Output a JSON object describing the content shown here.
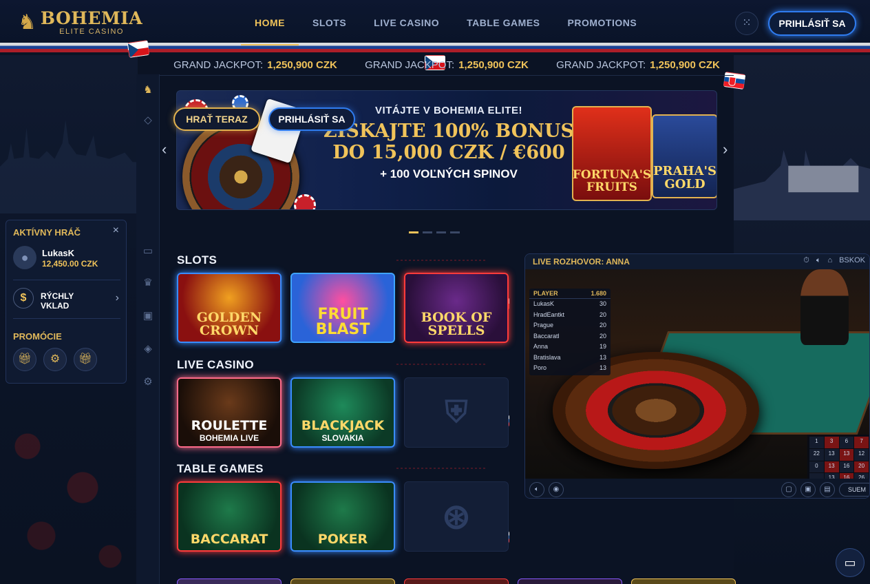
{
  "brand": {
    "name": "BOHEMIA",
    "subtitle": "ELITE CASINO"
  },
  "nav": {
    "items": [
      "HOME",
      "SLOTS",
      "LIVE CASINO",
      "TABLE GAMES",
      "PROMOTIONS"
    ],
    "active": "HOME"
  },
  "header": {
    "login_label": "PRIHLÁSIŤ SA",
    "grid_icon": "grid-icon"
  },
  "jackpots": [
    {
      "label": "GRAND JACKPOT:",
      "value": "1,250,900 CZK"
    },
    {
      "label": "GRAND JACKPOT:",
      "value": "1,250,900 CZK"
    },
    {
      "label": "GRAND JACKPOT:",
      "value": "1,250,900 CZK"
    }
  ],
  "hero": {
    "welcome": "VITÁJTE V BOHEMIA ELITE!",
    "bonus_line1": "ZÍSKAJTE 100% BONUS",
    "bonus_line2": "DO 15,000 CZK / €600",
    "spins": "+ 100 VOĽNÝCH SPINOV",
    "play_label": "HRAŤ TERAZ",
    "login_label": "PRIHLÁSIŤ SA",
    "tile1": "FORTUNA'S FRUITS",
    "tile2": "PRAHA'S GOLD",
    "slide_count": 4,
    "active_slide": 1
  },
  "player": {
    "header": "AKTÍVNY HRÁČ",
    "name": "LukasK",
    "balance": "12,450.00 CZK",
    "deposit_line1": "RÝCHLY",
    "deposit_line2": "VKLAD",
    "promo_header": "PROMÓCIE"
  },
  "sections": {
    "slots": {
      "title": "SLOTS",
      "flag": "cz"
    },
    "live": {
      "title": "LIVE CASINO",
      "flag": "sk"
    },
    "table": {
      "title": "TABLE GAMES",
      "flag": "sk"
    }
  },
  "games": {
    "slots": [
      {
        "title": "GOLDEN CROWN",
        "sub": ""
      },
      {
        "title": "FRUIT BLAST",
        "sub": ""
      },
      {
        "title": "BOOK OF SPELLS",
        "sub": ""
      }
    ],
    "live": [
      {
        "title": "ROULETTE",
        "sub": "BOHEMIA LIVE"
      },
      {
        "title": "BLACKJACK",
        "sub": "SLOVAKIA"
      }
    ],
    "table": [
      {
        "title": "BACCARAT",
        "sub": ""
      },
      {
        "title": "POKER",
        "sub": ""
      }
    ]
  },
  "live_panel": {
    "title": "LIVE ROZHOVOR: ANNA",
    "right_label": "BSKOK",
    "list_header": {
      "left": "PLAYER",
      "right": "1.680"
    },
    "rows": [
      {
        "name": "LukasK",
        "val": "30"
      },
      {
        "name": "HradEantkt",
        "val": "20"
      },
      {
        "name": "Prague",
        "val": "20"
      },
      {
        "name": "Baccaratl",
        "val": "20"
      },
      {
        "name": "Anna",
        "val": "19"
      },
      {
        "name": "Bratislava",
        "val": "13"
      },
      {
        "name": "Poro",
        "val": "13"
      }
    ],
    "score_cells": [
      "1",
      "3",
      "6",
      "7",
      "22",
      "13",
      "13",
      "12",
      "0",
      "13",
      "16",
      "20",
      "",
      "13",
      "16",
      "26"
    ],
    "foot_label": "SUEM"
  },
  "colors": {
    "gold": "#f0c35a",
    "blue_glow": "#2f7cf0",
    "red_glow": "#ff3b3b",
    "bg": "#0b1324"
  }
}
